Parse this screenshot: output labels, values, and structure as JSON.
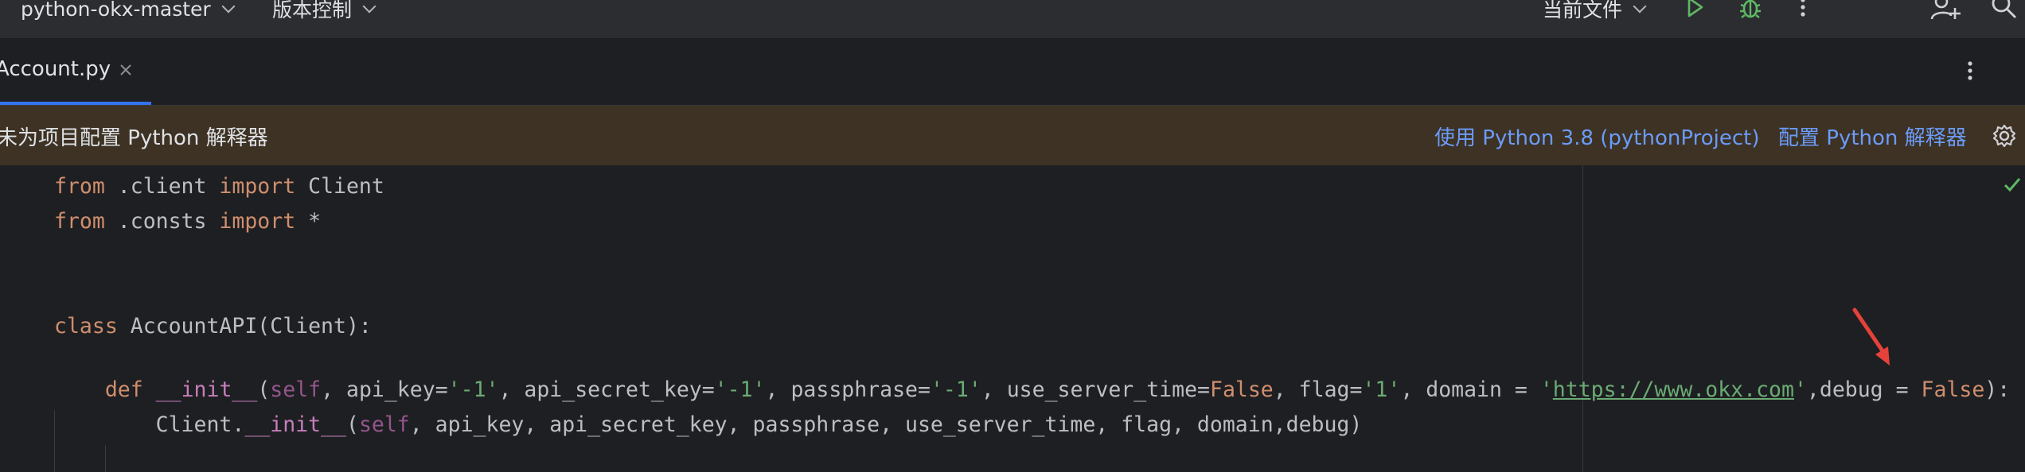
{
  "toolbar": {
    "project_label": "python-okx-master",
    "vcs_label": "版本控制",
    "run_config_label": "当前文件"
  },
  "tabs": [
    {
      "label": "Account.py",
      "active": true
    }
  ],
  "banner": {
    "message": "未为项目配置 Python 解释器",
    "use_interpreter_link": "使用 Python 3.8 (pythonProject)",
    "configure_link": "配置 Python 解释器"
  },
  "code": {
    "line1": {
      "kw_from": "from",
      "module": " .client ",
      "kw_import": "import",
      "name": " Client"
    },
    "line2": {
      "kw_from": "from",
      "module": " .consts ",
      "kw_import": "import",
      "name": " *"
    },
    "line3": {
      "kw_class": "class",
      "rest": " AccountAPI(Client):"
    },
    "line4": {
      "indent": "    ",
      "kw_def": "def",
      "sp": " ",
      "fn": "__init__",
      "p_open": "(",
      "self": "self",
      "a1": ", api_key=",
      "s1": "'-1'",
      "a2": ", api_secret_key=",
      "s2": "'-1'",
      "a3": ", passphrase=",
      "s3": "'-1'",
      "a4": ", use_server_time=",
      "false1": "False",
      "a5": ", flag=",
      "s4": "'1'",
      "a6": ", domain = ",
      "q1": "'",
      "url": "https://www.okx.com",
      "q2": "'",
      "a7": ",debug = ",
      "false2": "False",
      "end": "):"
    },
    "line5": {
      "indent": "        ",
      "cls": "Client.",
      "fn": "__init__",
      "p_open": "(",
      "self": "self",
      "rest": ", api_key, api_secret_key, passphrase, use_server_time, flag, domain,debug)"
    }
  },
  "colors": {
    "accent": "#3574f0",
    "keyword": "#cf8e6d",
    "string": "#6aab73",
    "self": "#94558d",
    "banner_bg": "#3d3223",
    "annotation_arrow": "#e5423a"
  },
  "icons": [
    "run-icon",
    "debug-icon",
    "more-vertical-icon",
    "add-user-icon",
    "search-icon",
    "close-icon",
    "settings-icon",
    "check-icon",
    "annotation-arrow-icon"
  ]
}
